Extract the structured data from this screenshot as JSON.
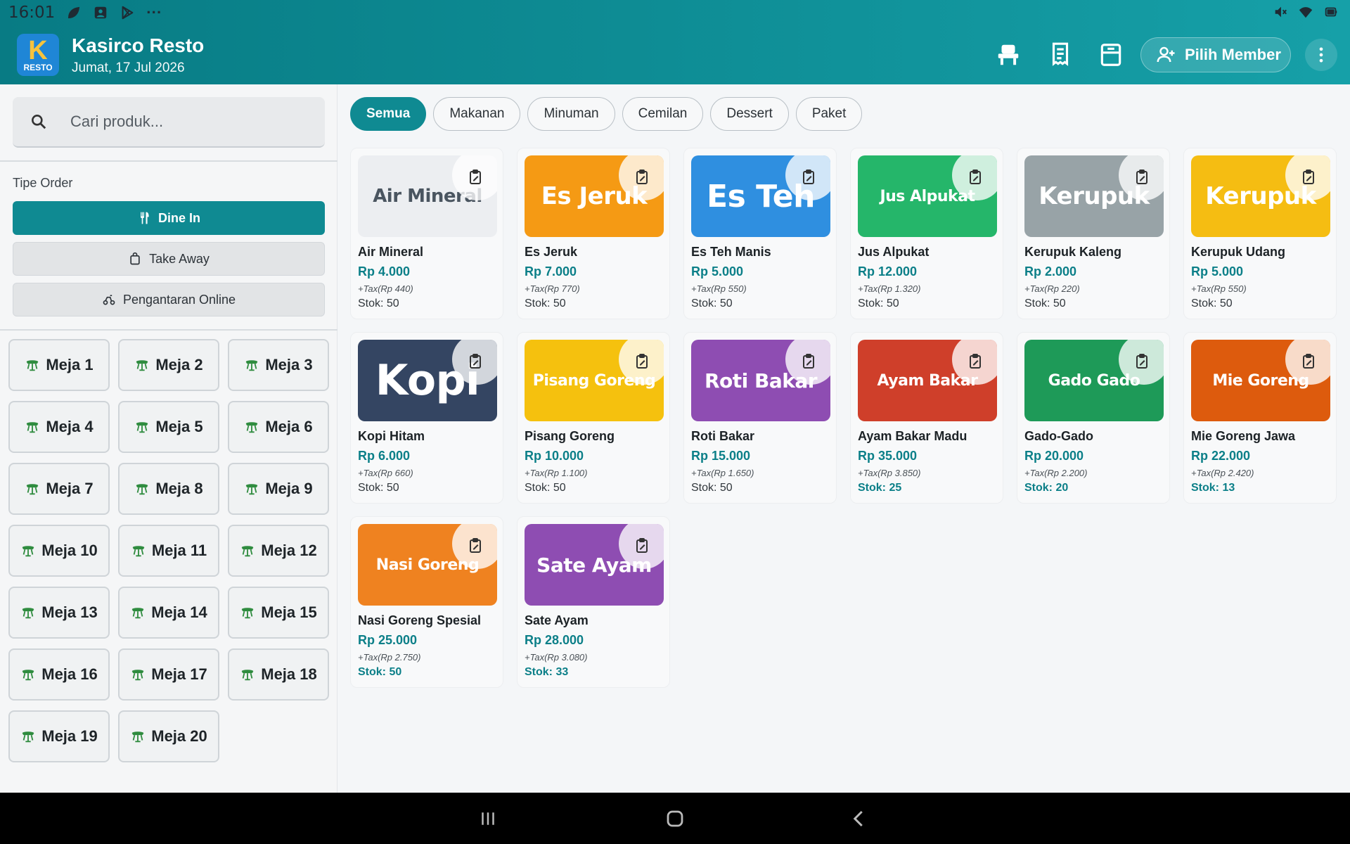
{
  "status_bar": {
    "time": "16:01",
    "more": "···"
  },
  "header": {
    "logo_letter": "K",
    "logo_sub": "RESTO",
    "title": "Kasirco Resto",
    "date": "Jumat, 17 Jul 2026",
    "icons": [
      "table-seat-icon",
      "receipt-icon",
      "cash-drawer-icon"
    ],
    "member_button": "Pilih Member",
    "more_icon": "more-vert-icon"
  },
  "search": {
    "placeholder": "Cari produk..."
  },
  "order_type": {
    "label": "Tipe Order",
    "options": [
      {
        "label": "Dine In",
        "icon": "utensils-icon",
        "active": true
      },
      {
        "label": "Take Away",
        "icon": "bag-icon",
        "active": false
      },
      {
        "label": "Pengantaran Online",
        "icon": "scooter-icon",
        "active": false
      }
    ]
  },
  "tables": [
    "Meja 1",
    "Meja 2",
    "Meja 3",
    "Meja 4",
    "Meja 5",
    "Meja 6",
    "Meja 7",
    "Meja 8",
    "Meja 9",
    "Meja 10",
    "Meja 11",
    "Meja 12",
    "Meja 13",
    "Meja 14",
    "Meja 15",
    "Meja 16",
    "Meja 17",
    "Meja 18",
    "Meja 19",
    "Meja 20"
  ],
  "categories": [
    {
      "label": "Semua",
      "active": true
    },
    {
      "label": "Makanan",
      "active": false
    },
    {
      "label": "Minuman",
      "active": false
    },
    {
      "label": "Cemilan",
      "active": false
    },
    {
      "label": "Dessert",
      "active": false
    },
    {
      "label": "Paket",
      "active": false
    }
  ],
  "products": [
    {
      "thumb": "Air Mineral",
      "name": "Air Mineral",
      "price": "Rp 4.000",
      "tax": "+Tax(Rp 440)",
      "stock": "Stok: 50",
      "low": false,
      "color": "#eceef1",
      "thumb_color": "#4a5560"
    },
    {
      "thumb": "Es Jeruk",
      "name": "Es Jeruk",
      "price": "Rp 7.000",
      "tax": "+Tax(Rp 770)",
      "stock": "Stok: 50",
      "low": false,
      "color": "#f59a14",
      "thumb_color": "#ffffff"
    },
    {
      "thumb": "Es Teh",
      "name": "Es Teh Manis",
      "price": "Rp 5.000",
      "tax": "+Tax(Rp 550)",
      "stock": "Stok: 50",
      "low": false,
      "color": "#2f8fe0",
      "thumb_color": "#ffffff"
    },
    {
      "thumb": "Jus Alpukat",
      "name": "Jus Alpukat",
      "price": "Rp 12.000",
      "tax": "+Tax(Rp 1.320)",
      "stock": "Stok: 50",
      "low": false,
      "color": "#25b66a",
      "thumb_color": "#ffffff"
    },
    {
      "thumb": "Kerupuk",
      "name": "Kerupuk Kaleng",
      "price": "Rp 2.000",
      "tax": "+Tax(Rp 220)",
      "stock": "Stok: 50",
      "low": false,
      "color": "#98a3a7",
      "thumb_color": "#ffffff"
    },
    {
      "thumb": "Kerupuk",
      "name": "Kerupuk Udang",
      "price": "Rp 5.000",
      "tax": "+Tax(Rp 550)",
      "stock": "Stok: 50",
      "low": false,
      "color": "#f5bd12",
      "thumb_color": "#ffffff"
    },
    {
      "thumb": "Kopi",
      "name": "Kopi Hitam",
      "price": "Rp 6.000",
      "tax": "+Tax(Rp 660)",
      "stock": "Stok: 50",
      "low": false,
      "color": "#344562",
      "thumb_color": "#ffffff"
    },
    {
      "thumb": "Pisang Goreng",
      "name": "Pisang Goreng",
      "price": "Rp 10.000",
      "tax": "+Tax(Rp 1.100)",
      "stock": "Stok: 50",
      "low": false,
      "color": "#f5c10e",
      "thumb_color": "#ffffff"
    },
    {
      "thumb": "Roti Bakar",
      "name": "Roti Bakar",
      "price": "Rp 15.000",
      "tax": "+Tax(Rp 1.650)",
      "stock": "Stok: 50",
      "low": false,
      "color": "#8e4db2",
      "thumb_color": "#ffffff"
    },
    {
      "thumb": "Ayam Bakar",
      "name": "Ayam Bakar Madu",
      "price": "Rp 35.000",
      "tax": "+Tax(Rp 3.850)",
      "stock": "Stok: 25",
      "low": true,
      "color": "#cf3f2a",
      "thumb_color": "#ffffff"
    },
    {
      "thumb": "Gado Gado",
      "name": "Gado-Gado",
      "price": "Rp 20.000",
      "tax": "+Tax(Rp 2.200)",
      "stock": "Stok: 20",
      "low": true,
      "color": "#1e9a58",
      "thumb_color": "#ffffff"
    },
    {
      "thumb": "Mie Goreng",
      "name": "Mie Goreng Jawa",
      "price": "Rp 22.000",
      "tax": "+Tax(Rp 2.420)",
      "stock": "Stok: 13",
      "low": true,
      "color": "#dd5b0d",
      "thumb_color": "#ffffff"
    },
    {
      "thumb": "Nasi Goreng",
      "name": "Nasi Goreng Spesial",
      "price": "Rp 25.000",
      "tax": "+Tax(Rp 2.750)",
      "stock": "Stok: 50",
      "low": true,
      "color": "#ef8220",
      "thumb_color": "#ffffff"
    },
    {
      "thumb": "Sate Ayam",
      "name": "Sate Ayam",
      "price": "Rp 28.000",
      "tax": "+Tax(Rp 3.080)",
      "stock": "Stok: 33",
      "low": true,
      "color": "#8e4db2",
      "thumb_color": "#ffffff"
    }
  ],
  "nav": [
    "recents-icon",
    "home-icon",
    "back-icon"
  ]
}
